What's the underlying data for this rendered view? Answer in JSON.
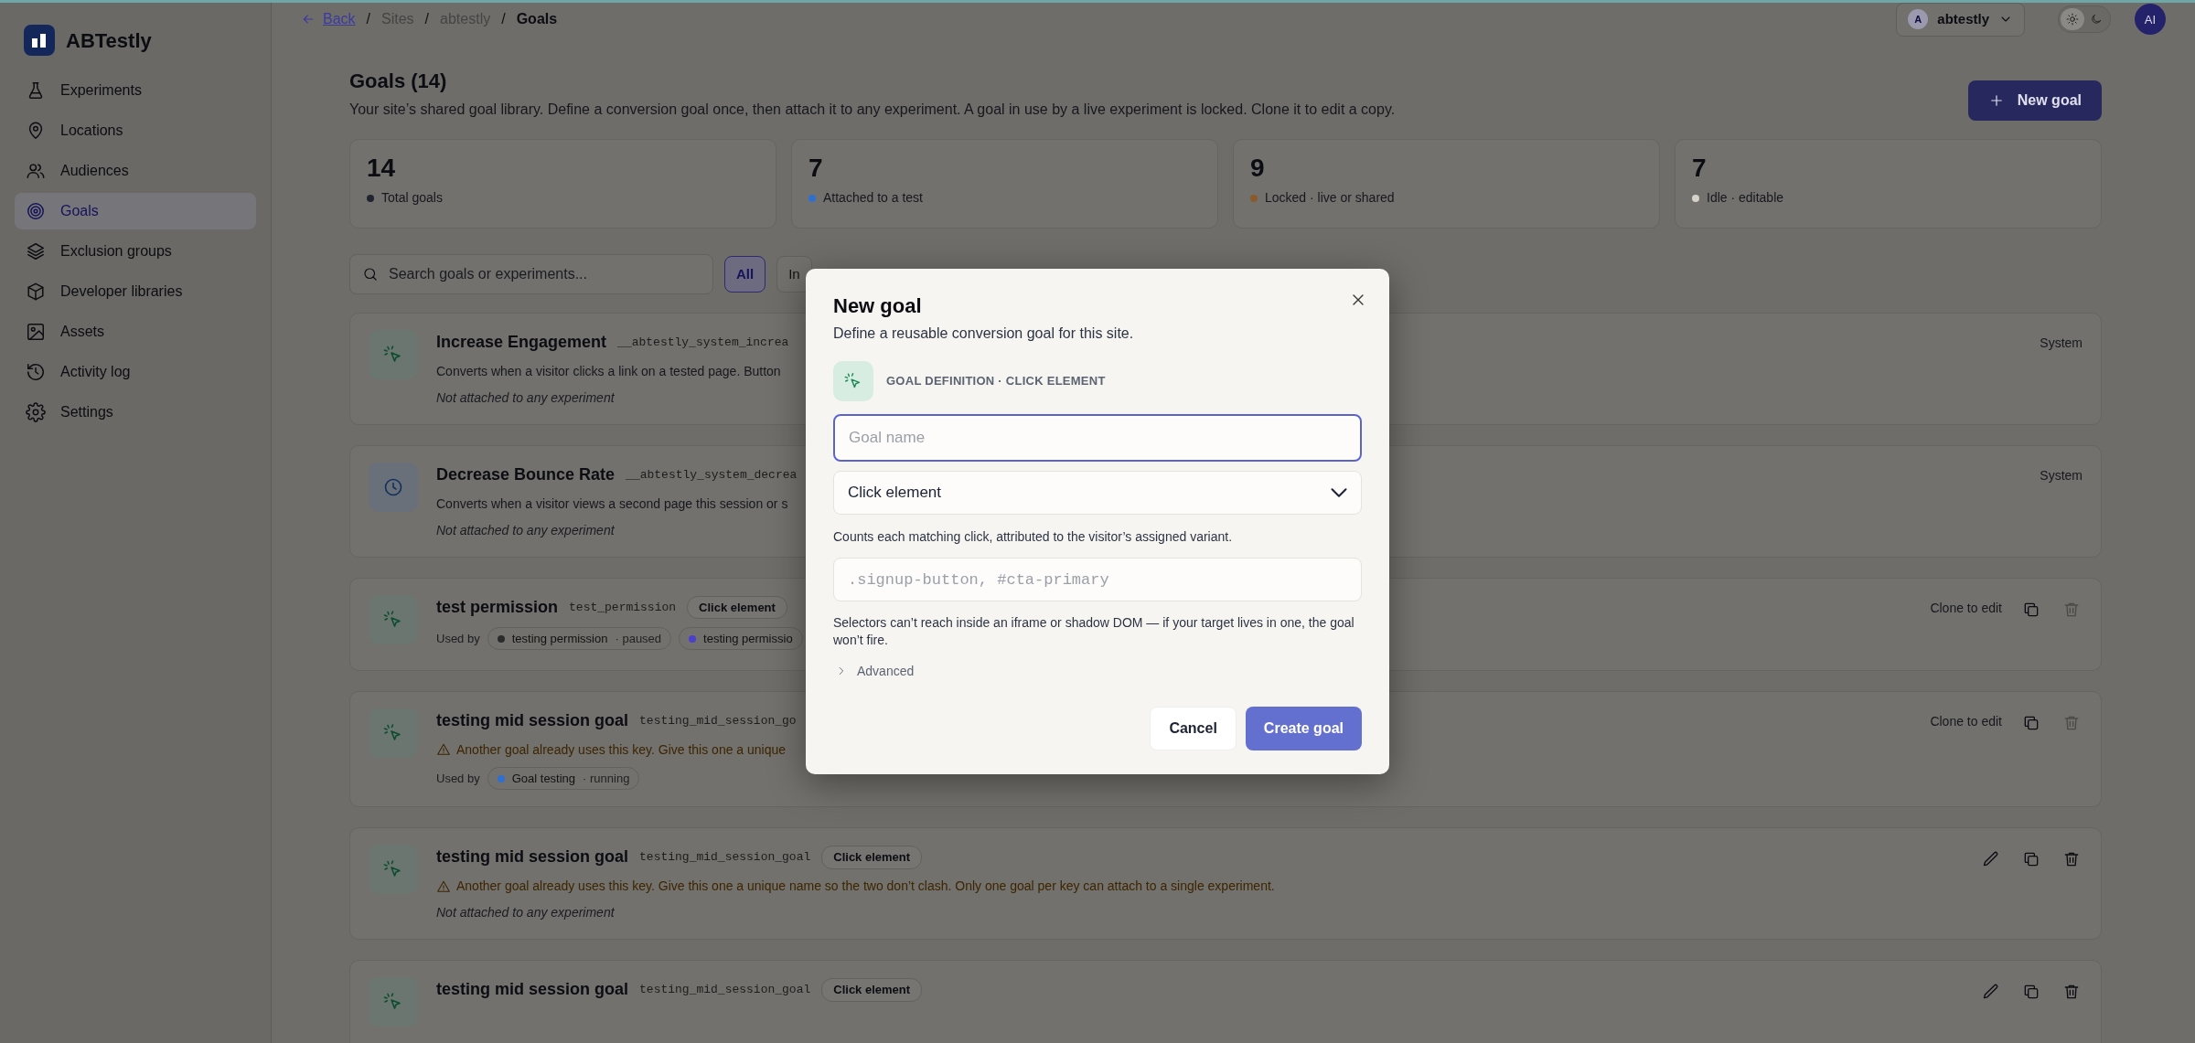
{
  "sidebar": {
    "brand": "ABTestly",
    "items": [
      {
        "label": "Experiments",
        "selected": false
      },
      {
        "label": "Locations",
        "selected": false
      },
      {
        "label": "Audiences",
        "selected": false
      },
      {
        "label": "Goals",
        "selected": true
      },
      {
        "label": "Exclusion groups",
        "selected": false
      },
      {
        "label": "Developer libraries",
        "selected": false
      },
      {
        "label": "Assets",
        "selected": false
      },
      {
        "label": "Activity log",
        "selected": false
      },
      {
        "label": "Settings",
        "selected": false
      }
    ]
  },
  "topbar": {
    "back": "Back",
    "separator": "/",
    "breadcrumbs": [
      "Sites",
      "abtestly",
      "Goals"
    ],
    "workspace": {
      "initial": "A",
      "name": "abtestly"
    },
    "theme": [
      {
        "selected": true
      },
      {
        "selected": false
      }
    ],
    "avatar": "AI"
  },
  "page": {
    "title": "Goals (14)",
    "description": "Your site’s shared goal library. Define a conversion goal once, then attach it to any experiment. A goal in use by a live experiment is locked. Clone it to edit a copy.",
    "new_goal_button": "New goal"
  },
  "stats": [
    {
      "value": "14",
      "label": "Total goals",
      "color": "#1f2430"
    },
    {
      "value": "7",
      "label": "Attached to a test",
      "color": "#2f6fd0"
    },
    {
      "value": "9",
      "label": "Locked · live or shared",
      "color": "#8a5a2b"
    },
    {
      "value": "7",
      "label": "Idle · editable",
      "color": "#d6d2ca"
    }
  ],
  "filters": {
    "search_placeholder": "Search goals or experiments...",
    "chips": [
      {
        "label": "All",
        "selected": true
      },
      {
        "label": "In",
        "selected": false
      }
    ]
  },
  "goals": [
    {
      "kind": "click",
      "title": "Increase Engagement",
      "key": "__abtestly_system_increa",
      "description": "Converts when a visitor clicks a link on a tested page. Button",
      "note": "Not attached to any experiment",
      "system_label": "System"
    },
    {
      "kind": "clock",
      "title": "Decrease Bounce Rate",
      "key": "__abtestly_system_decrea",
      "description": "Converts when a visitor views a second page this session or s",
      "note": "Not attached to any experiment",
      "system_label": "System"
    },
    {
      "kind": "click",
      "title": "test permission",
      "key": "test_permission",
      "badge": "Click element",
      "used_by_label": "Used by",
      "used_by": [
        {
          "name": "testing permission",
          "status": "· paused",
          "color": "#2b2b2b"
        },
        {
          "name": "testing permissio",
          "color": "#4b3fd0"
        }
      ],
      "clone_label": "Clone to edit",
      "editable": false,
      "delete_disabled": true
    },
    {
      "kind": "click",
      "title": "testing mid session goal",
      "key": "testing_mid_session_go",
      "warning": "Another goal already uses this key. Give this one a unique",
      "used_by_label": "Used by",
      "used_by": [
        {
          "name": "Goal testing",
          "status": "· running",
          "color": "#2f6fd0"
        }
      ],
      "clone_label": "Clone to edit",
      "editable": false,
      "delete_disabled": true
    },
    {
      "kind": "click",
      "title": "testing mid session goal",
      "key": "testing_mid_session_goal",
      "badge": "Click element",
      "warning": "Another goal already uses this key. Give this one a unique name so the two don’t clash. Only one goal per key can attach to a single experiment.",
      "note": "Not attached to any experiment",
      "editable": true,
      "delete_disabled": false
    },
    {
      "kind": "click",
      "title": "testing mid session goal",
      "key": "testing_mid_session_goal",
      "badge": "Click element",
      "editable": true,
      "delete_disabled": false
    }
  ],
  "modal": {
    "title": "New goal",
    "subtitle": "Define a reusable conversion goal for this site.",
    "section_label": "GOAL DEFINITION · CLICK ELEMENT",
    "name_field": {
      "placeholder": "Goal name",
      "focused": true
    },
    "type_select": {
      "value": "Click element"
    },
    "type_hint": "Counts each matching click, attributed to the visitor’s assigned variant.",
    "selector_field": {
      "placeholder": ".signup-button, #cta-primary"
    },
    "warning": "Selectors can’t reach inside an iframe or shadow DOM — if your target lives in one, the goal won’t fire.",
    "advanced": {
      "label": "Advanced",
      "expanded": false
    },
    "buttons": [
      {
        "label": "Cancel",
        "kind": "secondary"
      },
      {
        "label": "Create goal",
        "kind": "primary"
      }
    ]
  }
}
